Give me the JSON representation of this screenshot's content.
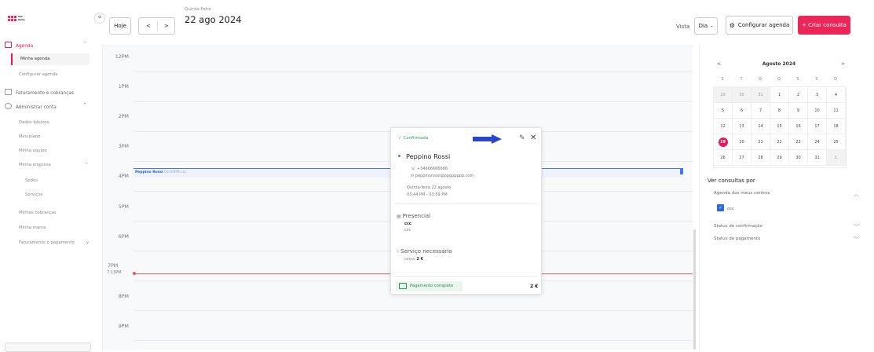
{
  "brand": {
    "logo_text": "Vet Suite",
    "accent": "#e8175d"
  },
  "sidebar": {
    "collapse_icon": "«",
    "items": [
      {
        "label": "Agenda",
        "chev": "^",
        "icon": "calendar-icon"
      },
      {
        "label": "Faturamento e cobranças",
        "icon": "billing-icon"
      },
      {
        "label": "Administrar conta",
        "chev": "^",
        "icon": "settings-icon"
      }
    ],
    "agenda_sub": [
      "Minha agenda",
      "Configurar agenda"
    ],
    "admin_sub": [
      "Dados básicos",
      "Meu plano",
      "Minha equipe",
      "Minha empresa"
    ],
    "empresa_chev": "^",
    "empresa_sub": [
      "Sedes",
      "Serviços"
    ],
    "billing_sub": [
      "Minhas cobranças",
      "Minha marca",
      "Faturamento e pagamento"
    ],
    "billing_chev": "v"
  },
  "topbar": {
    "today": "Hoje",
    "prev": "<",
    "next": ">",
    "weekday": "Quinta-Feira",
    "date": "22 ago 2024",
    "view_label": "Vista",
    "view_value": "Dia",
    "config_button": "Configurar agenda",
    "create_button": "+ Criar consulta"
  },
  "calendar": {
    "hours": [
      "12PM",
      "1PM",
      "2PM",
      "3PM",
      "4PM",
      "5PM",
      "6PM",
      "7PM",
      "8PM",
      "9PM"
    ],
    "now_label": "7:13PM",
    "event": {
      "name": "Peppino Rossi",
      "time": "03:44PM",
      "service": "ccc"
    }
  },
  "popup": {
    "status": "✓ Confirmada",
    "client": "Peppino Rossi",
    "phone": "+34666666666",
    "email": "peppinorossi@pppppppp.com",
    "date_line": "Quinta-feira 22 agosto",
    "time_line": "03:44 PM - 03:59 PM",
    "location_title": "Presencial",
    "location_name": "ccc",
    "location_sub": "ccc",
    "service_title": "Serviço necessário",
    "service_item": "ccccc",
    "service_price": "2 €",
    "payment_label": "Pagamento completo",
    "payment_amount": "2 €"
  },
  "minical": {
    "title": "Agosto 2024",
    "prev": "<",
    "next": ">",
    "weekdays": [
      "S",
      "T",
      "Q",
      "Q",
      "S",
      "S",
      "D"
    ],
    "weeks": [
      [
        "29",
        "30",
        "31",
        "1",
        "2",
        "3",
        "4"
      ],
      [
        "5",
        "6",
        "7",
        "8",
        "9",
        "10",
        "11"
      ],
      [
        "12",
        "13",
        "14",
        "15",
        "16",
        "17",
        "18"
      ],
      [
        "19",
        "20",
        "21",
        "22",
        "23",
        "24",
        "25"
      ],
      [
        "26",
        "27",
        "28",
        "29",
        "30",
        "31",
        "1"
      ]
    ],
    "today": "19"
  },
  "filters": {
    "title": "Ver consultas por",
    "centers": "Agenda dos meus centros",
    "center_item": "ccc",
    "confirm_status": "Status de confirmação",
    "payment_status": "Status de pagamento"
  }
}
